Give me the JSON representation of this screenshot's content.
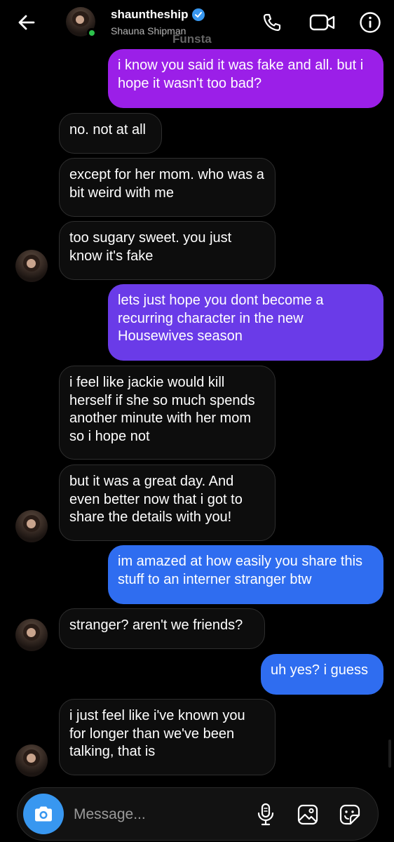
{
  "header": {
    "username": "shauntheship",
    "display_name": "Shauna Shipman",
    "tag": "Funsta"
  },
  "messages": [
    {
      "id": "m1",
      "side": "out",
      "text": "i know you said it was fake and all. but i hope it wasn't too bad?"
    },
    {
      "id": "m2",
      "side": "in",
      "text": "no. not at all"
    },
    {
      "id": "m3",
      "side": "in",
      "text": "except for her mom. who was a bit weird with me"
    },
    {
      "id": "m4",
      "side": "in",
      "text": "too sugary sweet. you just know it's fake"
    },
    {
      "id": "m5",
      "side": "out",
      "text": "lets just hope you dont become a recurring character in the new Housewives season"
    },
    {
      "id": "m6",
      "side": "in",
      "text": "i feel like jackie would kill herself if she so much spends another minute with her mom so i hope not"
    },
    {
      "id": "m7",
      "side": "in",
      "text": "but it was a great day.  And even better now that i got to share the details with you!"
    },
    {
      "id": "m8",
      "side": "out",
      "text": "im amazed at how easily you share this stuff to an interner stranger btw"
    },
    {
      "id": "m9",
      "side": "in",
      "text": "stranger? aren't we friends?"
    },
    {
      "id": "m10",
      "side": "out",
      "text": "uh yes? i guess"
    },
    {
      "id": "m11",
      "side": "in",
      "text": "i just feel like i've known you for longer than we've been talking, that is"
    }
  ],
  "composer": {
    "placeholder": "Message..."
  },
  "icons": {
    "back": "back-arrow-icon",
    "call": "phone-icon",
    "video": "video-camera-icon",
    "info": "info-icon",
    "camera": "camera-icon",
    "mic": "microphone-icon",
    "gallery": "gallery-icon",
    "sticker": "sticker-icon"
  },
  "colors": {
    "background": "#000000",
    "incoming_bubble": "#0d0d0d",
    "outgoing_top": "#9b1fe8",
    "outgoing_mid": "#6a3be8",
    "outgoing_bottom": "#2f6df0",
    "accent": "#3897f0",
    "online": "#2dc34c"
  }
}
